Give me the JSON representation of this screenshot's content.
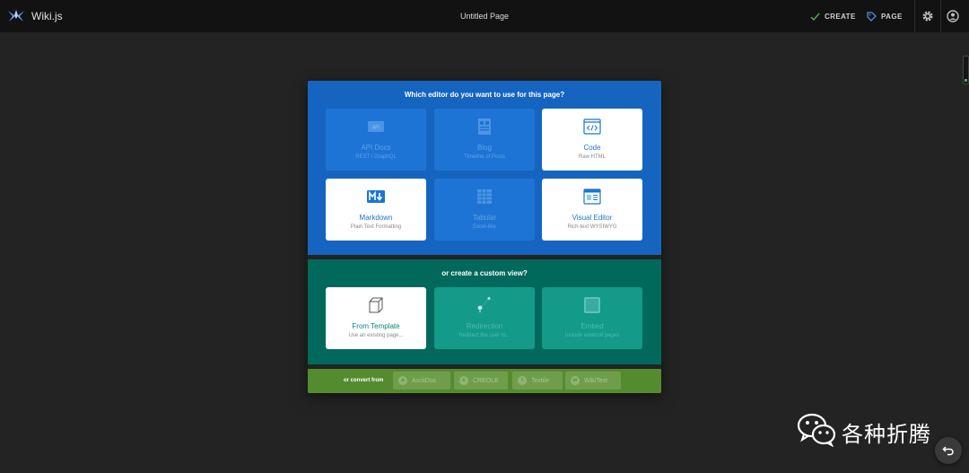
{
  "header": {
    "brand": "Wiki.js",
    "page_title": "Untitled Page",
    "create_label": "CREATE",
    "page_label": "PAGE",
    "icons": [
      "wikijs-logo-icon",
      "check-icon",
      "tag-icon",
      "gear-icon",
      "account-icon"
    ]
  },
  "editor_select": {
    "title": "Which editor do you want to use for this page?",
    "editors": [
      {
        "label": "API Docs",
        "sub": "REST / GraphQL",
        "icon": "api-icon",
        "enabled": false
      },
      {
        "label": "Blog",
        "sub": "Timeline of Posts",
        "icon": "blog-icon",
        "enabled": false
      },
      {
        "label": "Code",
        "sub": "Raw HTML",
        "icon": "code-icon",
        "enabled": true
      },
      {
        "label": "Markdown",
        "sub": "Plain Text Formatting",
        "icon": "markdown-icon",
        "enabled": true
      },
      {
        "label": "Tabular",
        "sub": "Excel-like",
        "icon": "table-icon",
        "enabled": false
      },
      {
        "label": "Visual Editor",
        "sub": "Rich-text WYSIWYG",
        "icon": "visual-editor-icon",
        "enabled": true
      }
    ]
  },
  "custom_view": {
    "title": "or create a custom view?",
    "options": [
      {
        "label": "From Template",
        "sub": "Use an existing page...",
        "icon": "template-icon",
        "enabled": true
      },
      {
        "label": "Redirection",
        "sub": "Redirect the user to...",
        "icon": "redirect-icon",
        "enabled": false
      },
      {
        "label": "Embed",
        "sub": "Include external pages",
        "icon": "embed-icon",
        "enabled": false
      }
    ]
  },
  "convert": {
    "label": "or convert from",
    "formats": [
      {
        "label": "AsciiDoc",
        "badge": "a"
      },
      {
        "label": "CREOLE",
        "badge": "c"
      },
      {
        "label": "Textile",
        "badge": "t"
      },
      {
        "label": "WikiText",
        "badge": "w"
      }
    ]
  },
  "watermark": {
    "text": "各种折腾",
    "icon": "wechat-icon"
  },
  "colors": {
    "blue": "#1565c0",
    "teal": "#00695c",
    "green": "#558b2f",
    "accent": "#1976d2"
  }
}
